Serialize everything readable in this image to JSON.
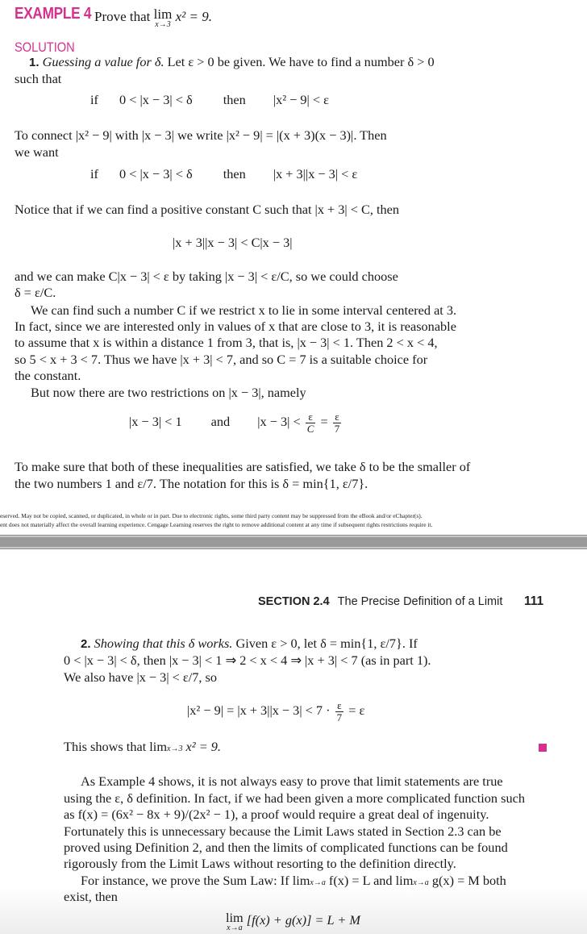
{
  "example": {
    "label": "EXAMPLE 4",
    "statement_prefix": "Prove that",
    "lim": "lim",
    "lim_under": "x→3",
    "statement_expr": "x² = 9."
  },
  "solution_label": "SOLUTION",
  "part1": {
    "number": "1.",
    "heading": "Guessing a value for δ.",
    "line1_rest": "Let ε > 0 be given. We have to find a number δ > 0",
    "line2": "such that",
    "cond1": {
      "if": "if",
      "left": "0 < |x − 3| < δ",
      "then": "then",
      "right": "|x² − 9| < ε"
    },
    "connect_line1": "To connect |x² − 9| with |x − 3| we write |x² − 9| = |(x + 3)(x − 3)|. Then",
    "connect_line2": "we want",
    "cond2": {
      "if": "if",
      "left": "0 < |x − 3| < δ",
      "then": "then",
      "right": "|x + 3||x − 3| < ε"
    },
    "notice_line": "Notice that if we can find a positive constant C such that |x + 3| < C, then",
    "display1": "|x + 3||x − 3| < C|x − 3|",
    "choose_line1": "and we can make C|x − 3| < ε by taking |x − 3| < ε/C, so we could choose",
    "choose_line2": "δ = ε/C.",
    "para_restrict": [
      "We can find such a number C if we restrict x to lie in some interval centered at 3.",
      "In fact, since we are interested only in values of x that are close to 3, it is reasonable",
      "to assume that x is within a distance 1 from 3, that is, |x − 3| < 1. Then 2 < x < 4,",
      "so 5 < x + 3 < 7. Thus we have |x + 3| < 7, and so C = 7 is a suitable choice for",
      "the constant."
    ],
    "two_restrictions": "But now there are two restrictions on |x − 3|, namely",
    "display2": {
      "left": "|x − 3| < 1",
      "and": "and",
      "right_prefix": "|x − 3| <",
      "frac1_num": "ε",
      "frac1_den": "C",
      "eq": "=",
      "frac2_num": "ε",
      "frac2_den": "7"
    },
    "make_sure": [
      "To make sure that both of these inequalities are satisfied, we take δ to be the smaller of",
      "the two numbers 1 and ε/7. The notation for this is δ = min{1, ε/7}."
    ]
  },
  "copyright": [
    "eserved. May not be copied, scanned, or duplicated, in whole or in part. Due to electronic rights, some third party content may be suppressed from the eBook and/or eChapter(s).",
    "ent does not materially affect the overall learning experience. Cengage Learning reserves the right to remove additional content at any time if subsequent rights restrictions require it."
  ],
  "running_head": {
    "section": "SECTION 2.4",
    "title": "The Precise Definition of a Limit",
    "page": "111"
  },
  "part2": {
    "number": "2.",
    "heading": "Showing that this δ works.",
    "line1_rest": "Given ε > 0, let δ = min{1, ε/7}. If",
    "line2": "0 < |x − 3| < δ, then |x − 3| < 1 ⇒ 2 < x < 4 ⇒ |x + 3| < 7 (as in part 1).",
    "line3": "We also have |x − 3| < ε/7, so",
    "display_left": "|x² − 9| = |x + 3||x − 3| < 7 ·",
    "display_frac_num": "ε",
    "display_frac_den": "7",
    "display_right": "= ε",
    "conclusion_prefix": "This shows that lim",
    "conclusion_sub": "x→3",
    "conclusion_rest": " x² = 9."
  },
  "discussion": {
    "para1": [
      "As Example 4 shows, it is not always easy to prove that limit statements are true",
      "using the ε, δ definition. In fact, if we had been given a more complicated function such",
      "as f(x) = (6x² − 8x + 9)/(2x² − 1), a proof would require a great deal of ingenuity.",
      "Fortunately this is unnecessary because the Limit Laws stated in Section 2.3 can be",
      "proved using Definition 2, and then the limits of complicated functions can be found",
      "rigorously from the Limit Laws without resorting to the definition directly."
    ],
    "para2_line1_a": "For instance, we prove the Sum Law: If lim",
    "para2_sub1": "x→a",
    "para2_line1_b": " f(x) = L and lim",
    "para2_sub2": "x→a",
    "para2_line1_c": " g(x) = M both",
    "para2_line2": "exist, then",
    "sum_law_lim": "lim",
    "sum_law_under": "x→a",
    "sum_law_expr": "[f(x) + g(x)] = L + M"
  },
  "colors": {
    "accent": "#d6308f",
    "separator": "#9a9a9a"
  }
}
